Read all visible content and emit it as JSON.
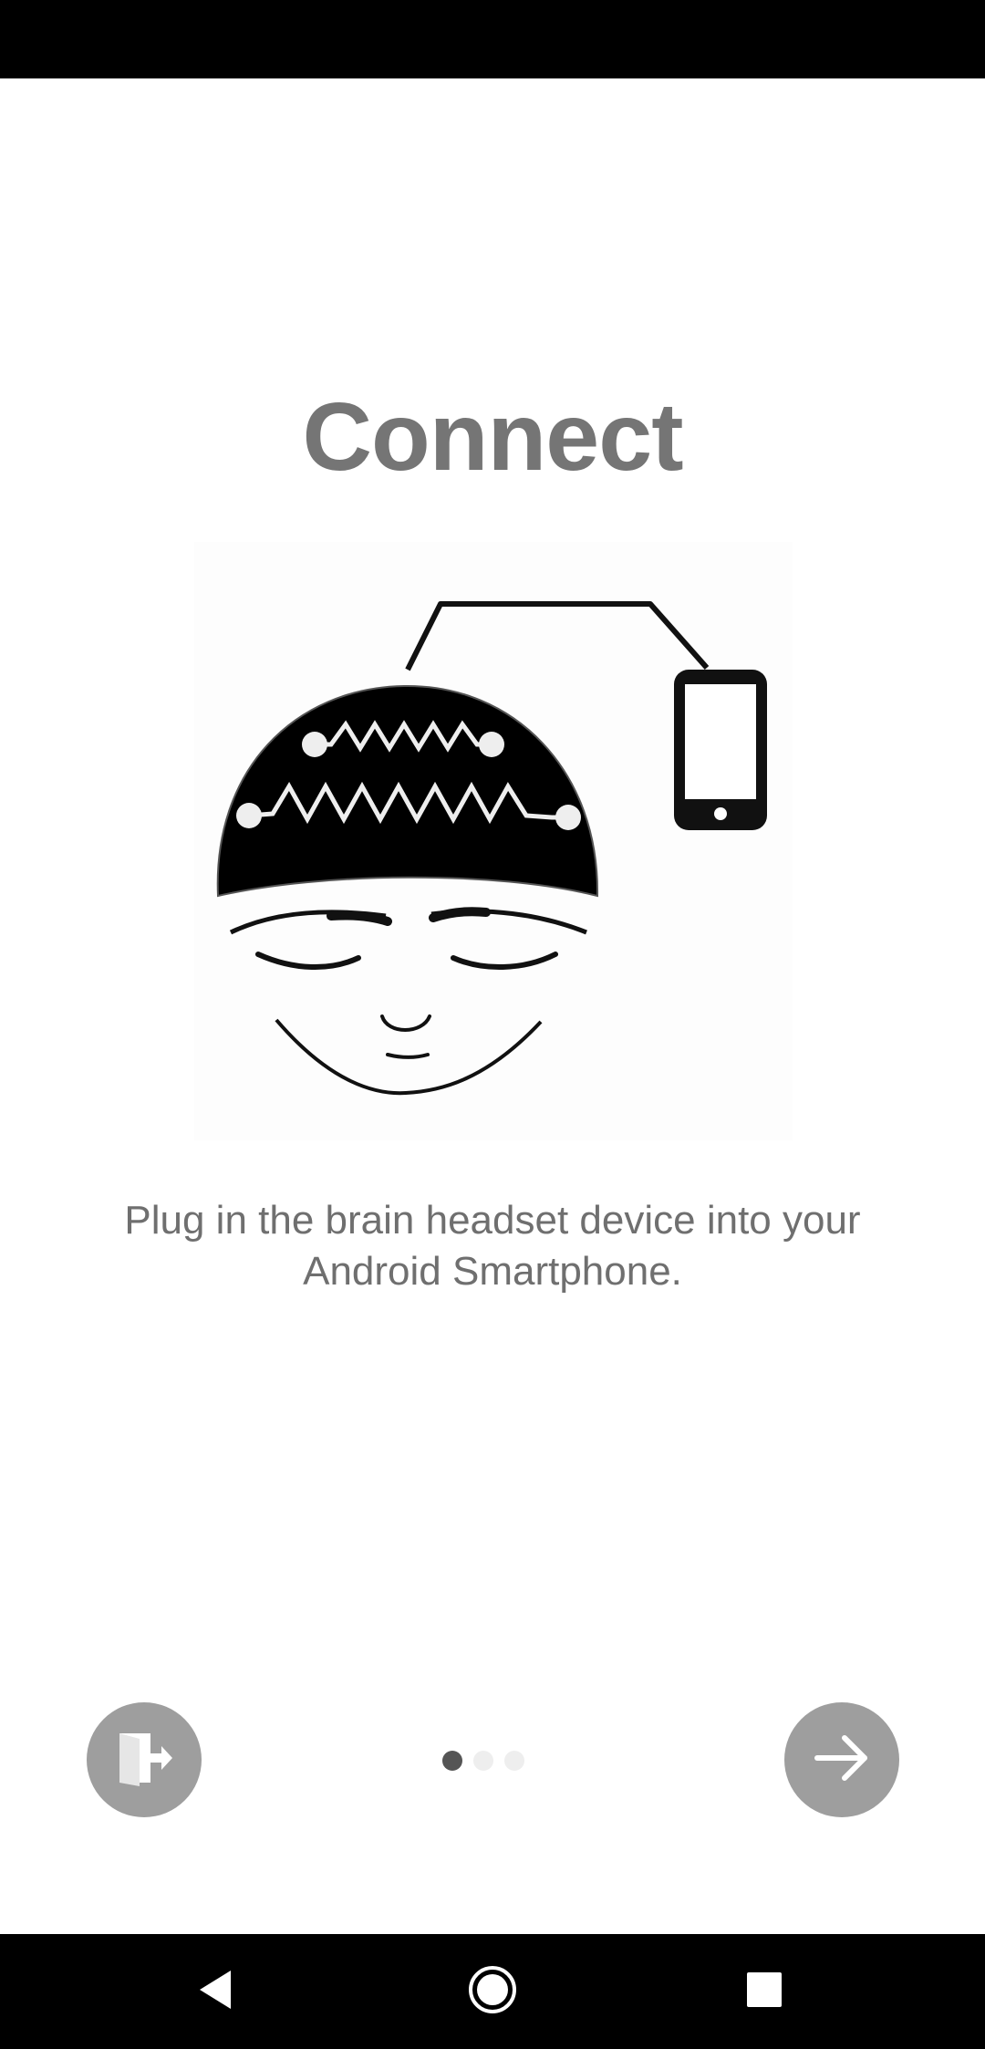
{
  "onboarding": {
    "title": "Connect",
    "description": "Plug in the brain headset device into your Android Smartphone.",
    "page_indicator": {
      "current_page": 1,
      "total_pages": 3
    },
    "exit_button": {
      "icon": "exit-door-icon"
    },
    "next_button": {
      "icon": "arrow-right-icon"
    },
    "illustration": {
      "icon": "brain-headset-phone-illustration"
    }
  },
  "system_nav": {
    "back_icon": "back-triangle-icon",
    "home_icon": "home-circle-icon",
    "recents_icon": "recents-square-icon"
  },
  "colors": {
    "title": "#757575",
    "description": "#6f6f6f",
    "button_bg": "#9e9e9e",
    "dot_active": "#555555",
    "dot_inactive": "#eeeeee",
    "system_bars": "#000000"
  }
}
